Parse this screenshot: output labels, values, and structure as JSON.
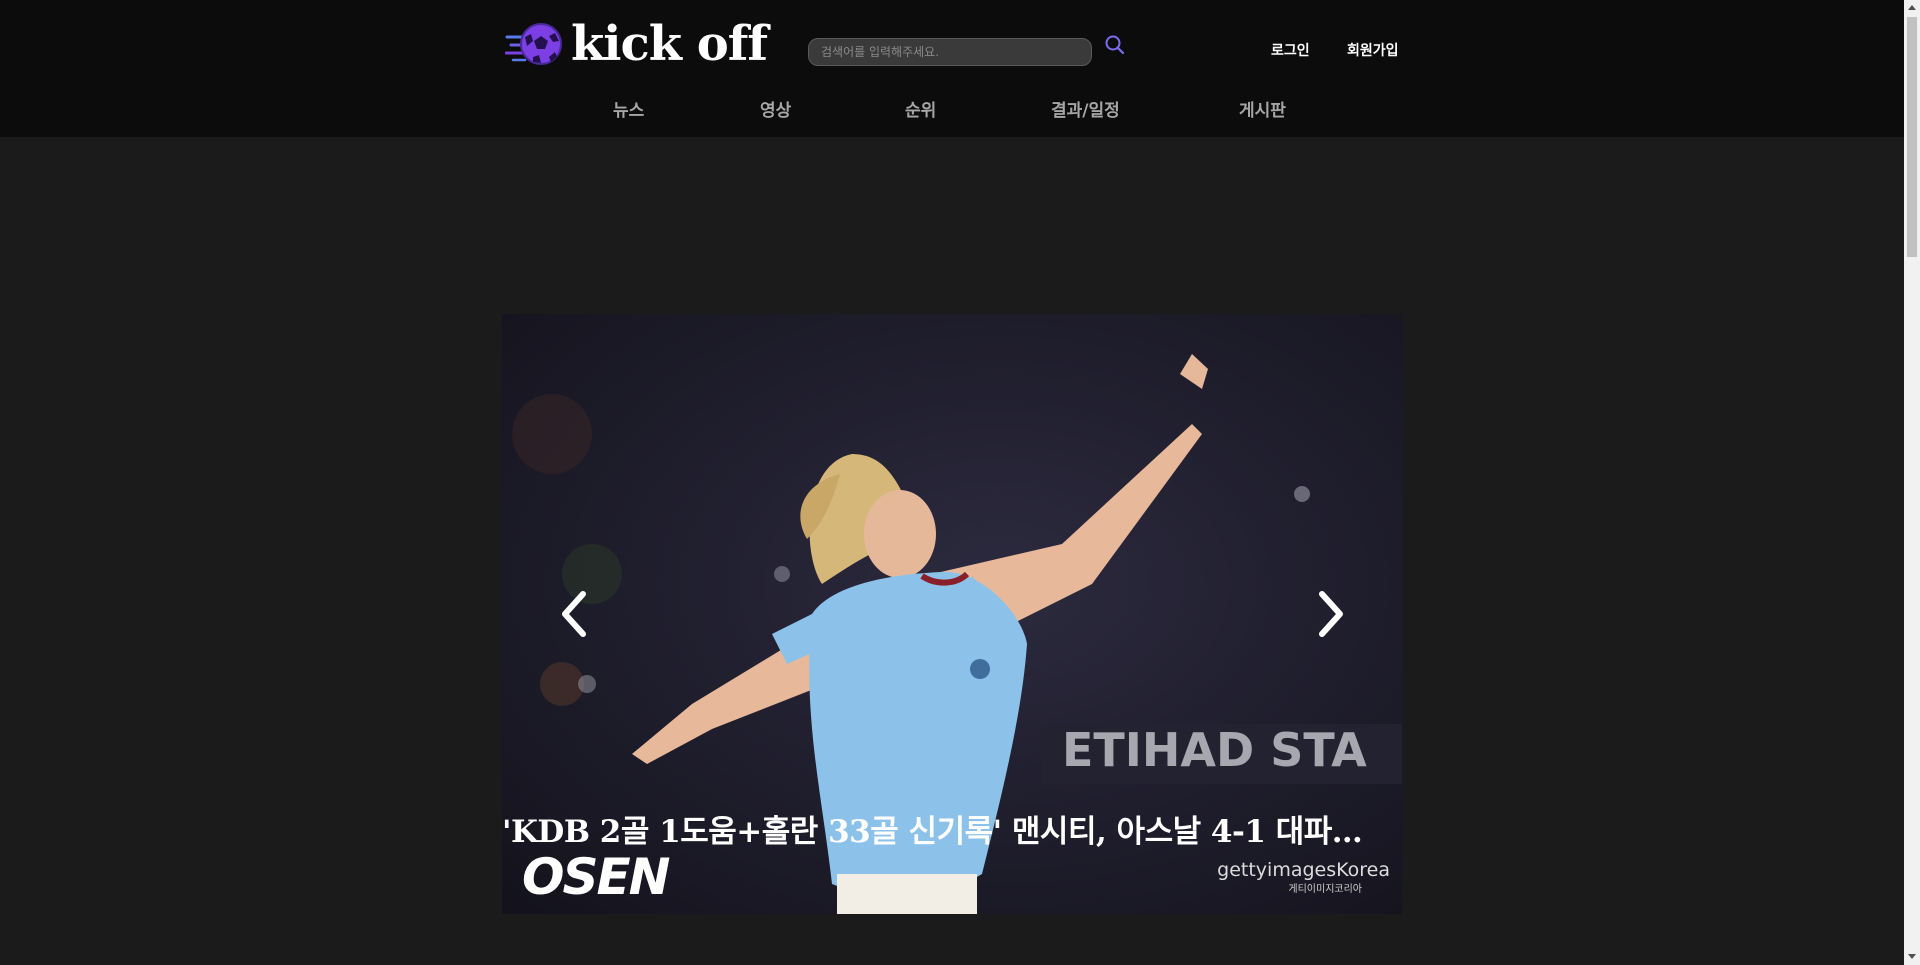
{
  "header": {
    "logo_text": "kick off",
    "search": {
      "placeholder": "검색어를 입력해주세요.",
      "value": ""
    },
    "login_label": "로그인",
    "signup_label": "회원가입"
  },
  "nav": {
    "items": [
      "뉴스",
      "영상",
      "순위",
      "결과/일정",
      "게시판"
    ]
  },
  "carousel": {
    "title": "'KDB 2골 1도움+홀란 33골 신기록' 맨시티, 아스날 4-1 대파하고 선두 추격",
    "image_captions": {
      "stadium_sign": "ETIHAD STA",
      "watermark_left": "OSEN",
      "watermark_right": "gettyimagesKorea",
      "watermark_right_sub": "게티이미지코리아"
    }
  },
  "colors": {
    "header_bg": "#0c0c0c",
    "page_bg": "#1b1b1b",
    "accent": "#7b3fe4",
    "nav_text": "#a6a6a6",
    "jersey": "#8cc2ea"
  },
  "icons": [
    "soccer-ball-logo-icon",
    "search-icon",
    "chevron-left-icon",
    "chevron-right-icon"
  ]
}
